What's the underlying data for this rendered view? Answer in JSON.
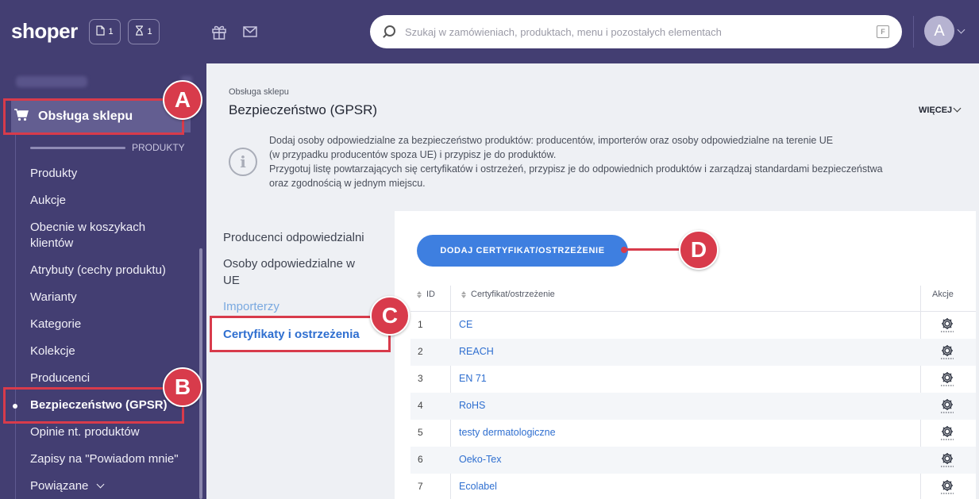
{
  "header": {
    "logo": "shoper",
    "counters": [
      {
        "icon": "document-icon",
        "count": "1"
      },
      {
        "icon": "hourglass-icon",
        "count": "1"
      }
    ],
    "search": {
      "placeholder": "Szukaj w zamówieniach, produktach, menu i pozostałych elementach",
      "shortcut": "F"
    },
    "avatar_letter": "A"
  },
  "sidebar": {
    "section": "Obsługa sklepu",
    "group_label": "PRODUKTY",
    "items": [
      {
        "label": "Produkty"
      },
      {
        "label": "Aukcje"
      },
      {
        "label": "Obecnie w koszykach klientów"
      },
      {
        "label": "Atrybuty (cechy produktu)"
      },
      {
        "label": "Warianty"
      },
      {
        "label": "Kategorie"
      },
      {
        "label": "Kolekcje"
      },
      {
        "label": "Producenci"
      },
      {
        "label": "Bezpieczeństwo (GPSR)",
        "active": true
      },
      {
        "label": "Opinie nt. produktów"
      },
      {
        "label": "Zapisy na \"Powiadom mnie\""
      },
      {
        "label": "Powiązane"
      }
    ]
  },
  "page": {
    "breadcrumb": "Obsługa sklepu",
    "title": "Bezpieczeństwo (GPSR)",
    "more": "WIĘCEJ",
    "info_lines": [
      "Dodaj osoby odpowiedzialne za bezpieczeństwo produktów: producentów, importerów oraz osoby odpowiedzialne na terenie UE",
      "(w przypadku producentów spoza UE) i przypisz je do produktów.",
      "Przygotuj listę powtarzających się certyfikatów i ostrzeżeń, przypisz je do odpowiednich produktów i zarządzaj standardami bezpieczeństwa",
      "oraz zgodnością w jednym miejscu."
    ]
  },
  "subnav": {
    "items": [
      {
        "label": "Producenci odpowiedzialni"
      },
      {
        "label": "Osoby odpowiedzialne w UE"
      },
      {
        "label": "Importerzy"
      },
      {
        "label": "Certyfikaty i ostrzeżenia",
        "active": true
      }
    ]
  },
  "table": {
    "add_button": "DODAJ CERTYFIKAT/OSTRZEŻENIE",
    "columns": {
      "id": "ID",
      "name": "Certyfikat/ostrzeżenie",
      "actions": "Akcje"
    },
    "rows": [
      {
        "id": "1",
        "name": "CE"
      },
      {
        "id": "2",
        "name": "REACH"
      },
      {
        "id": "3",
        "name": "EN 71"
      },
      {
        "id": "4",
        "name": "RoHS"
      },
      {
        "id": "5",
        "name": "testy dermatologiczne"
      },
      {
        "id": "6",
        "name": "Oeko-Tex"
      },
      {
        "id": "7",
        "name": "Ecolabel"
      }
    ]
  },
  "annotations": {
    "a": "A",
    "b": "B",
    "c": "C",
    "d": "D"
  },
  "colors": {
    "sidebar": "#433e72",
    "accent": "#3e7fe0",
    "annotation": "#d83b4b",
    "link": "#2f6fd0"
  }
}
